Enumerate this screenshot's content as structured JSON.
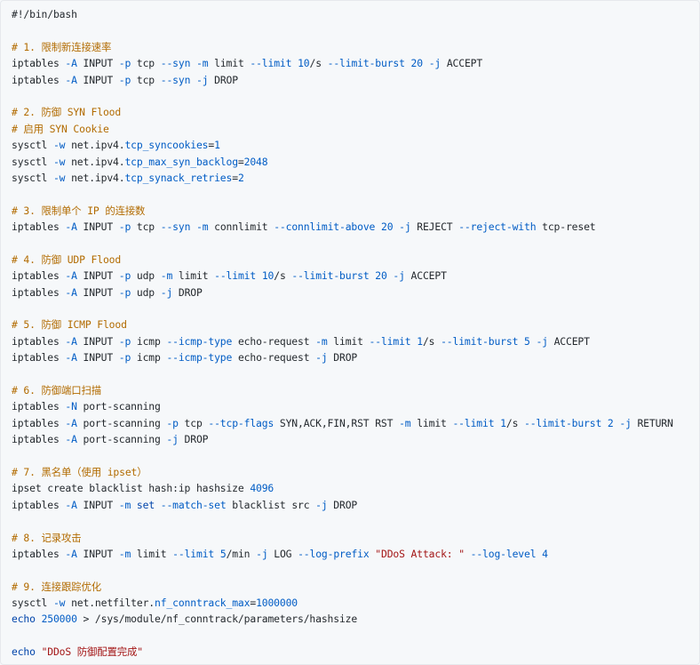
{
  "code": {
    "language": "bash",
    "colors": {
      "background": "#f6f8fa",
      "plain": "#24292e",
      "comment": "#b26b00",
      "opt": "#005cc5",
      "num": "#005cc5",
      "str": "#a31515",
      "kw": "#0044aa"
    },
    "lines": [
      [
        {
          "t": "#!/bin/bash",
          "c": "plain"
        }
      ],
      [],
      [
        {
          "t": "# 1. 限制新连接速率",
          "c": "comment"
        }
      ],
      [
        {
          "t": "iptables ",
          "c": "plain"
        },
        {
          "t": "-A",
          "c": "opt"
        },
        {
          "t": " INPUT ",
          "c": "plain"
        },
        {
          "t": "-p",
          "c": "opt"
        },
        {
          "t": " tcp ",
          "c": "plain"
        },
        {
          "t": "--syn",
          "c": "opt"
        },
        {
          "t": " ",
          "c": "plain"
        },
        {
          "t": "-m",
          "c": "opt"
        },
        {
          "t": " limit ",
          "c": "plain"
        },
        {
          "t": "--limit",
          "c": "opt"
        },
        {
          "t": " ",
          "c": "plain"
        },
        {
          "t": "10",
          "c": "num"
        },
        {
          "t": "/s ",
          "c": "plain"
        },
        {
          "t": "--limit-burst",
          "c": "opt"
        },
        {
          "t": " ",
          "c": "plain"
        },
        {
          "t": "20",
          "c": "num"
        },
        {
          "t": " ",
          "c": "plain"
        },
        {
          "t": "-j",
          "c": "opt"
        },
        {
          "t": " ACCEPT",
          "c": "plain"
        }
      ],
      [
        {
          "t": "iptables ",
          "c": "plain"
        },
        {
          "t": "-A",
          "c": "opt"
        },
        {
          "t": " INPUT ",
          "c": "plain"
        },
        {
          "t": "-p",
          "c": "opt"
        },
        {
          "t": " tcp ",
          "c": "plain"
        },
        {
          "t": "--syn",
          "c": "opt"
        },
        {
          "t": " ",
          "c": "plain"
        },
        {
          "t": "-j",
          "c": "opt"
        },
        {
          "t": " DROP",
          "c": "plain"
        }
      ],
      [],
      [
        {
          "t": "# 2. 防御 SYN Flood",
          "c": "comment"
        }
      ],
      [
        {
          "t": "# 启用 SYN Cookie",
          "c": "comment"
        }
      ],
      [
        {
          "t": "sysctl ",
          "c": "plain"
        },
        {
          "t": "-w",
          "c": "opt"
        },
        {
          "t": " net.ipv4.",
          "c": "plain"
        },
        {
          "t": "tcp_syncookies",
          "c": "opt"
        },
        {
          "t": "=",
          "c": "plain"
        },
        {
          "t": "1",
          "c": "num"
        }
      ],
      [
        {
          "t": "sysctl ",
          "c": "plain"
        },
        {
          "t": "-w",
          "c": "opt"
        },
        {
          "t": " net.ipv4.",
          "c": "plain"
        },
        {
          "t": "tcp_max_syn_backlog",
          "c": "opt"
        },
        {
          "t": "=",
          "c": "plain"
        },
        {
          "t": "2048",
          "c": "num"
        }
      ],
      [
        {
          "t": "sysctl ",
          "c": "plain"
        },
        {
          "t": "-w",
          "c": "opt"
        },
        {
          "t": " net.ipv4.",
          "c": "plain"
        },
        {
          "t": "tcp_synack_retries",
          "c": "opt"
        },
        {
          "t": "=",
          "c": "plain"
        },
        {
          "t": "2",
          "c": "num"
        }
      ],
      [],
      [
        {
          "t": "# 3. 限制单个 IP 的连接数",
          "c": "comment"
        }
      ],
      [
        {
          "t": "iptables ",
          "c": "plain"
        },
        {
          "t": "-A",
          "c": "opt"
        },
        {
          "t": " INPUT ",
          "c": "plain"
        },
        {
          "t": "-p",
          "c": "opt"
        },
        {
          "t": " tcp ",
          "c": "plain"
        },
        {
          "t": "--syn",
          "c": "opt"
        },
        {
          "t": " ",
          "c": "plain"
        },
        {
          "t": "-m",
          "c": "opt"
        },
        {
          "t": " connlimit ",
          "c": "plain"
        },
        {
          "t": "--connlimit-above",
          "c": "opt"
        },
        {
          "t": " ",
          "c": "plain"
        },
        {
          "t": "20",
          "c": "num"
        },
        {
          "t": " ",
          "c": "plain"
        },
        {
          "t": "-j",
          "c": "opt"
        },
        {
          "t": " REJECT ",
          "c": "plain"
        },
        {
          "t": "--reject-with",
          "c": "opt"
        },
        {
          "t": " tcp-reset",
          "c": "plain"
        }
      ],
      [],
      [
        {
          "t": "# 4. 防御 UDP Flood",
          "c": "comment"
        }
      ],
      [
        {
          "t": "iptables ",
          "c": "plain"
        },
        {
          "t": "-A",
          "c": "opt"
        },
        {
          "t": " INPUT ",
          "c": "plain"
        },
        {
          "t": "-p",
          "c": "opt"
        },
        {
          "t": " udp ",
          "c": "plain"
        },
        {
          "t": "-m",
          "c": "opt"
        },
        {
          "t": " limit ",
          "c": "plain"
        },
        {
          "t": "--limit",
          "c": "opt"
        },
        {
          "t": " ",
          "c": "plain"
        },
        {
          "t": "10",
          "c": "num"
        },
        {
          "t": "/s ",
          "c": "plain"
        },
        {
          "t": "--limit-burst",
          "c": "opt"
        },
        {
          "t": " ",
          "c": "plain"
        },
        {
          "t": "20",
          "c": "num"
        },
        {
          "t": " ",
          "c": "plain"
        },
        {
          "t": "-j",
          "c": "opt"
        },
        {
          "t": " ACCEPT",
          "c": "plain"
        }
      ],
      [
        {
          "t": "iptables ",
          "c": "plain"
        },
        {
          "t": "-A",
          "c": "opt"
        },
        {
          "t": " INPUT ",
          "c": "plain"
        },
        {
          "t": "-p",
          "c": "opt"
        },
        {
          "t": " udp ",
          "c": "plain"
        },
        {
          "t": "-j",
          "c": "opt"
        },
        {
          "t": " DROP",
          "c": "plain"
        }
      ],
      [],
      [
        {
          "t": "# 5. 防御 ICMP Flood",
          "c": "comment"
        }
      ],
      [
        {
          "t": "iptables ",
          "c": "plain"
        },
        {
          "t": "-A",
          "c": "opt"
        },
        {
          "t": " INPUT ",
          "c": "plain"
        },
        {
          "t": "-p",
          "c": "opt"
        },
        {
          "t": " icmp ",
          "c": "plain"
        },
        {
          "t": "--icmp-type",
          "c": "opt"
        },
        {
          "t": " echo-request ",
          "c": "plain"
        },
        {
          "t": "-m",
          "c": "opt"
        },
        {
          "t": " limit ",
          "c": "plain"
        },
        {
          "t": "--limit",
          "c": "opt"
        },
        {
          "t": " ",
          "c": "plain"
        },
        {
          "t": "1",
          "c": "num"
        },
        {
          "t": "/s ",
          "c": "plain"
        },
        {
          "t": "--limit-burst",
          "c": "opt"
        },
        {
          "t": " ",
          "c": "plain"
        },
        {
          "t": "5",
          "c": "num"
        },
        {
          "t": " ",
          "c": "plain"
        },
        {
          "t": "-j",
          "c": "opt"
        },
        {
          "t": " ACCEPT",
          "c": "plain"
        }
      ],
      [
        {
          "t": "iptables ",
          "c": "plain"
        },
        {
          "t": "-A",
          "c": "opt"
        },
        {
          "t": " INPUT ",
          "c": "plain"
        },
        {
          "t": "-p",
          "c": "opt"
        },
        {
          "t": " icmp ",
          "c": "plain"
        },
        {
          "t": "--icmp-type",
          "c": "opt"
        },
        {
          "t": " echo-request ",
          "c": "plain"
        },
        {
          "t": "-j",
          "c": "opt"
        },
        {
          "t": " DROP",
          "c": "plain"
        }
      ],
      [],
      [
        {
          "t": "# 6. 防御端口扫描",
          "c": "comment"
        }
      ],
      [
        {
          "t": "iptables ",
          "c": "plain"
        },
        {
          "t": "-N",
          "c": "opt"
        },
        {
          "t": " port-scanning",
          "c": "plain"
        }
      ],
      [
        {
          "t": "iptables ",
          "c": "plain"
        },
        {
          "t": "-A",
          "c": "opt"
        },
        {
          "t": " port-scanning ",
          "c": "plain"
        },
        {
          "t": "-p",
          "c": "opt"
        },
        {
          "t": " tcp ",
          "c": "plain"
        },
        {
          "t": "--tcp-flags",
          "c": "opt"
        },
        {
          "t": " SYN,ACK,FIN,RST RST ",
          "c": "plain"
        },
        {
          "t": "-m",
          "c": "opt"
        },
        {
          "t": " limit ",
          "c": "plain"
        },
        {
          "t": "--limit",
          "c": "opt"
        },
        {
          "t": " ",
          "c": "plain"
        },
        {
          "t": "1",
          "c": "num"
        },
        {
          "t": "/s ",
          "c": "plain"
        },
        {
          "t": "--limit-burst",
          "c": "opt"
        },
        {
          "t": " ",
          "c": "plain"
        },
        {
          "t": "2",
          "c": "num"
        },
        {
          "t": " ",
          "c": "plain"
        },
        {
          "t": "-j",
          "c": "opt"
        },
        {
          "t": " RETURN",
          "c": "plain"
        }
      ],
      [
        {
          "t": "iptables ",
          "c": "plain"
        },
        {
          "t": "-A",
          "c": "opt"
        },
        {
          "t": " port-scanning ",
          "c": "plain"
        },
        {
          "t": "-j",
          "c": "opt"
        },
        {
          "t": " DROP",
          "c": "plain"
        }
      ],
      [],
      [
        {
          "t": "# 7. 黑名单（使用 ipset）",
          "c": "comment"
        }
      ],
      [
        {
          "t": "ipset create blacklist hash:ip hashsize ",
          "c": "plain"
        },
        {
          "t": "4096",
          "c": "num"
        }
      ],
      [
        {
          "t": "iptables ",
          "c": "plain"
        },
        {
          "t": "-A",
          "c": "opt"
        },
        {
          "t": " INPUT ",
          "c": "plain"
        },
        {
          "t": "-m",
          "c": "opt"
        },
        {
          "t": " ",
          "c": "plain"
        },
        {
          "t": "set",
          "c": "kw"
        },
        {
          "t": " ",
          "c": "plain"
        },
        {
          "t": "--match-set",
          "c": "opt"
        },
        {
          "t": " blacklist src ",
          "c": "plain"
        },
        {
          "t": "-j",
          "c": "opt"
        },
        {
          "t": " DROP",
          "c": "plain"
        }
      ],
      [],
      [
        {
          "t": "# 8. 记录攻击",
          "c": "comment"
        }
      ],
      [
        {
          "t": "iptables ",
          "c": "plain"
        },
        {
          "t": "-A",
          "c": "opt"
        },
        {
          "t": " INPUT ",
          "c": "plain"
        },
        {
          "t": "-m",
          "c": "opt"
        },
        {
          "t": " limit ",
          "c": "plain"
        },
        {
          "t": "--limit",
          "c": "opt"
        },
        {
          "t": " ",
          "c": "plain"
        },
        {
          "t": "5",
          "c": "num"
        },
        {
          "t": "/min ",
          "c": "plain"
        },
        {
          "t": "-j",
          "c": "opt"
        },
        {
          "t": " LOG ",
          "c": "plain"
        },
        {
          "t": "--log-prefix",
          "c": "opt"
        },
        {
          "t": " ",
          "c": "plain"
        },
        {
          "t": "\"DDoS Attack: \"",
          "c": "str"
        },
        {
          "t": " ",
          "c": "plain"
        },
        {
          "t": "--log-level",
          "c": "opt"
        },
        {
          "t": " ",
          "c": "plain"
        },
        {
          "t": "4",
          "c": "num"
        }
      ],
      [],
      [
        {
          "t": "# 9. 连接跟踪优化",
          "c": "comment"
        }
      ],
      [
        {
          "t": "sysctl ",
          "c": "plain"
        },
        {
          "t": "-w",
          "c": "opt"
        },
        {
          "t": " net.netfilter.",
          "c": "plain"
        },
        {
          "t": "nf_conntrack_max",
          "c": "opt"
        },
        {
          "t": "=",
          "c": "plain"
        },
        {
          "t": "1000000",
          "c": "num"
        }
      ],
      [
        {
          "t": "echo",
          "c": "kw"
        },
        {
          "t": " ",
          "c": "plain"
        },
        {
          "t": "250000",
          "c": "num"
        },
        {
          "t": " > /sys/module/nf_conntrack/parameters/hashsize",
          "c": "plain"
        }
      ],
      [],
      [
        {
          "t": "echo",
          "c": "kw"
        },
        {
          "t": " ",
          "c": "plain"
        },
        {
          "t": "\"DDoS 防御配置完成\"",
          "c": "str"
        }
      ]
    ]
  }
}
